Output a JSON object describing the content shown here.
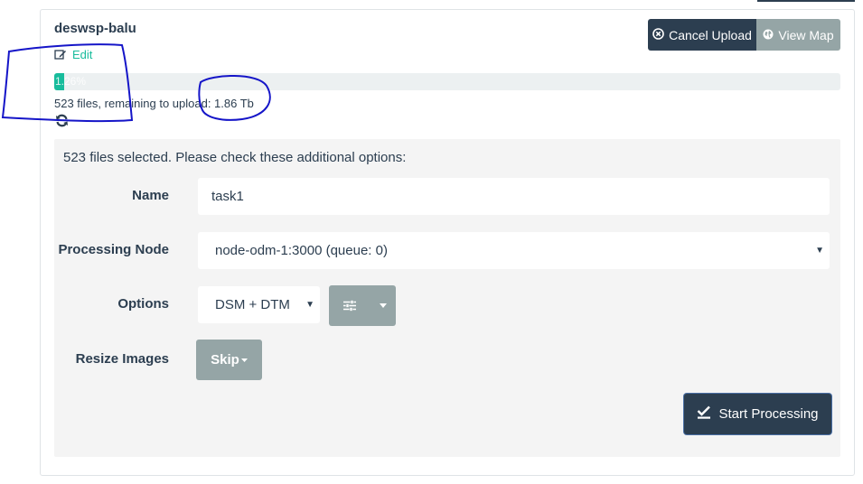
{
  "project": {
    "title": "deswsp-balu",
    "edit_label": "Edit"
  },
  "header_buttons": {
    "cancel_upload": "Cancel Upload",
    "view_map": "View Map"
  },
  "upload": {
    "progress_text": "1.26%",
    "progress_fraction": 0.0126,
    "status_text": "523 files, remaining to upload: 1.86 Tb"
  },
  "options": {
    "header": "523 files selected. Please check these additional options:",
    "name_label": "Name",
    "name_value": "task1",
    "node_label": "Processing Node",
    "node_value": "node-odm-1:3000 (queue: 0)",
    "options_label": "Options",
    "options_value": "DSM + DTM",
    "resize_label": "Resize Images",
    "resize_value": "Skip",
    "start_button": "Start Processing"
  },
  "colors": {
    "primary": "#2c3e50",
    "secondary": "#95a5a6",
    "accent": "#18bc9c",
    "annotation": "#1515c8"
  },
  "icons": [
    "edit-icon",
    "cancel-circle-icon",
    "globe-icon",
    "refresh-icon",
    "sliders-icon",
    "caret-down-icon",
    "checkmark-icon"
  ]
}
